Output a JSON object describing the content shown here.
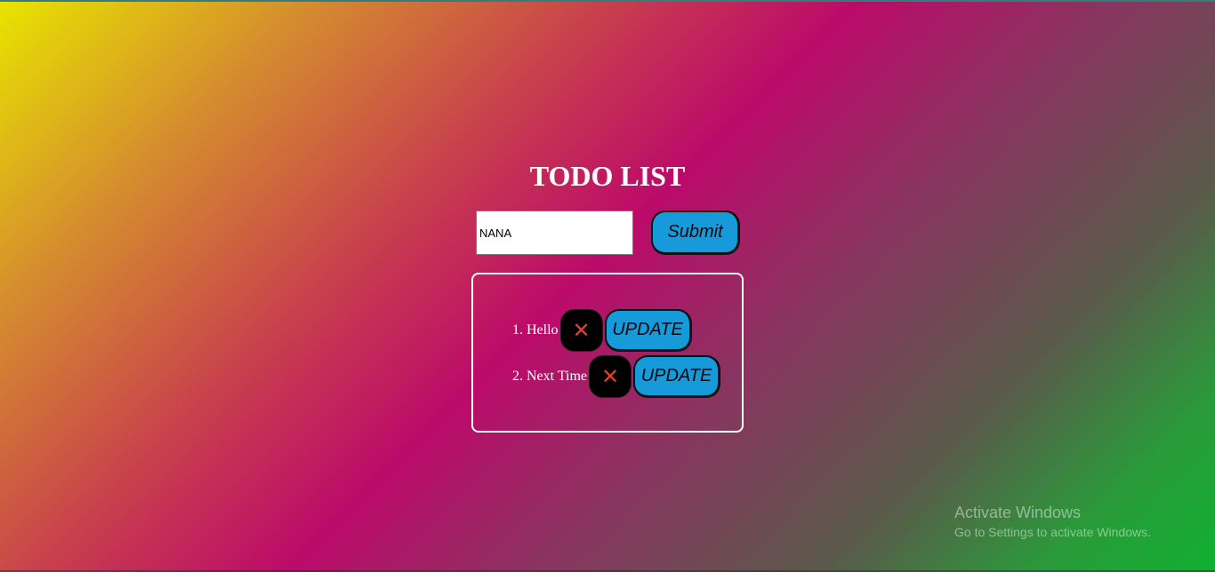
{
  "app": {
    "title": "TODO LIST"
  },
  "form": {
    "input_value": "NANA",
    "submit_label": "Submit"
  },
  "todos": [
    {
      "number": "1.",
      "text": "Hello",
      "delete_glyph": "✕",
      "update_label": "UPDATE"
    },
    {
      "number": "2.",
      "text": "Next Time",
      "delete_glyph": "✕",
      "update_label": "UPDATE"
    }
  ],
  "watermark": {
    "title": "Activate Windows",
    "subtitle": "Go to Settings to activate Windows."
  },
  "colors": {
    "button_blue": "#169ad9",
    "delete_bg": "#000000",
    "delete_icon": "#e5402a",
    "text": "#ffffff"
  },
  "icons": {
    "delete": "close-icon"
  }
}
